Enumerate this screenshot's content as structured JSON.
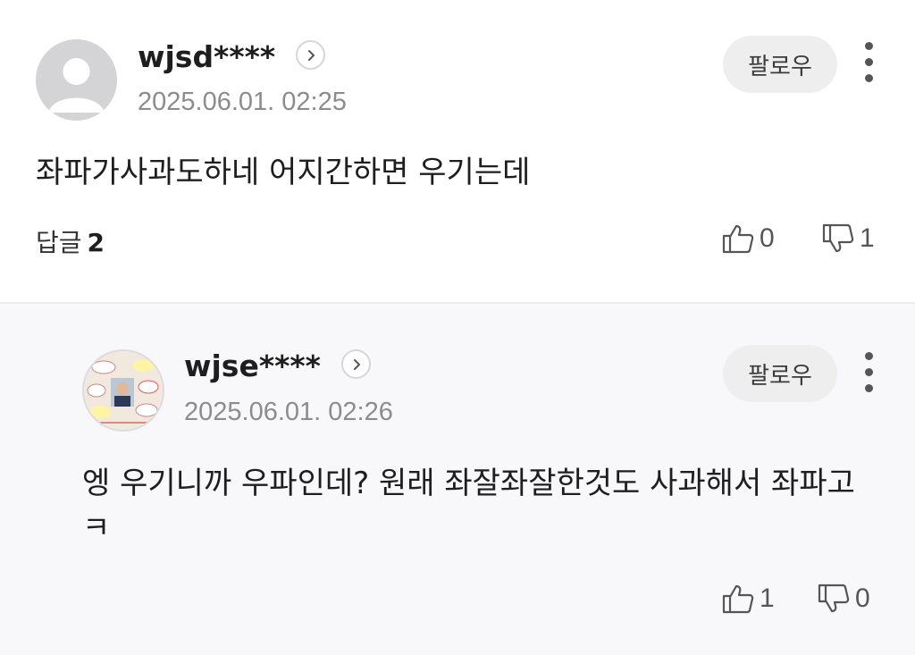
{
  "comments": [
    {
      "username": "wjsd****",
      "date": "2025.06.01. 02:25",
      "follow_label": "팔로우",
      "text": "좌파가사과도하네 어지간하면 우기는데",
      "reply_label": "답글",
      "reply_count": "2",
      "likes": "0",
      "dislikes": "1",
      "avatar_icon": "default-user-avatar"
    },
    {
      "username": "wjse****",
      "date": "2025.06.01. 02:26",
      "follow_label": "팔로우",
      "text": "엥 우기니까 우파인데? 원래 좌잘좌잘한것도 사과해서 좌파고ㅋ",
      "likes": "1",
      "dislikes": "0",
      "avatar_icon": "photo-avatar"
    }
  ],
  "colors": {
    "reply_background": "#f8f8fa",
    "follow_button": "#eeeeef",
    "meta_text": "#8c8c8c"
  }
}
